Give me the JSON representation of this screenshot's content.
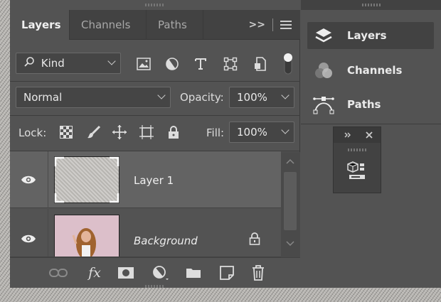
{
  "layers_panel": {
    "tabs": [
      {
        "label": "Layers",
        "active": true
      },
      {
        "label": "Channels",
        "active": false
      },
      {
        "label": "Paths",
        "active": false
      }
    ],
    "expand_glyph": ">>",
    "filter": {
      "label": "Kind"
    },
    "blend_mode": "Normal",
    "opacity": {
      "label": "Opacity:",
      "value": "100%"
    },
    "lock": {
      "label": "Lock:"
    },
    "fill": {
      "label": "Fill:",
      "value": "100%"
    },
    "layers": [
      {
        "name": "Layer 1",
        "visible": true,
        "selected": true,
        "italic": false
      },
      {
        "name": "Background",
        "visible": true,
        "selected": false,
        "italic": true,
        "locked": true
      }
    ],
    "footer_fx": "fx"
  },
  "collapsed_dock": {
    "items": [
      {
        "label": "Layers",
        "active": true
      },
      {
        "label": "Channels",
        "active": false
      },
      {
        "label": "Paths",
        "active": false
      }
    ]
  },
  "colors": {
    "panel_bg": "#535353",
    "tabbar_bg": "#424242",
    "selected_row": "#636363",
    "text": "#e6e6e6"
  }
}
